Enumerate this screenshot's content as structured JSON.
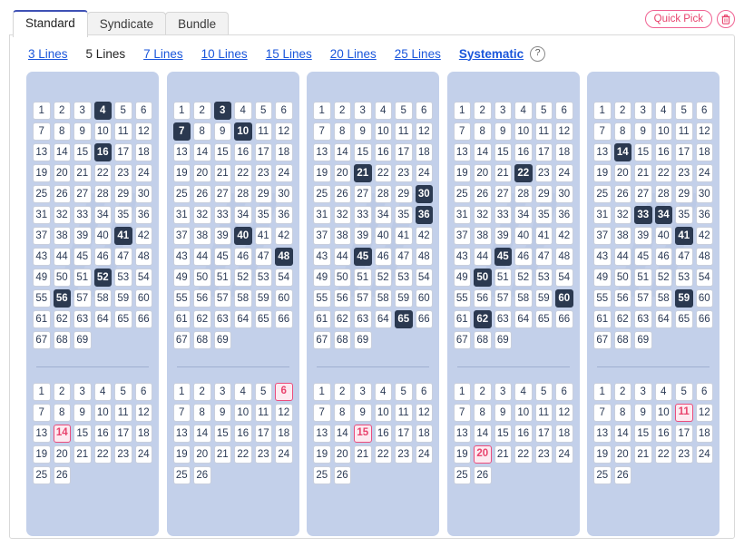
{
  "tabs": [
    {
      "label": "Standard",
      "active": true
    },
    {
      "label": "Syndicate",
      "active": false
    },
    {
      "label": "Bundle",
      "active": false
    }
  ],
  "actions": {
    "quick_pick_label": "Quick Pick",
    "trash_icon": "trash-icon"
  },
  "line_nav": {
    "items": [
      {
        "label": "3 Lines",
        "style": "link"
      },
      {
        "label": "5 Lines",
        "style": "plain"
      },
      {
        "label": "7 Lines",
        "style": "link"
      },
      {
        "label": "10 Lines",
        "style": "link"
      },
      {
        "label": "15 Lines",
        "style": "link"
      },
      {
        "label": "20 Lines",
        "style": "link"
      },
      {
        "label": "25 Lines",
        "style": "link"
      },
      {
        "label": "Systematic",
        "style": "link bold"
      }
    ],
    "help_icon_label": "?"
  },
  "board": {
    "main_range": {
      "min": 1,
      "max": 69,
      "columns": 6
    },
    "bonus_range": {
      "min": 1,
      "max": 26,
      "columns": 6
    },
    "colors": {
      "panel_bg": "#c3d0ea",
      "cell_bg": "#ffffff",
      "selected_bg": "#2b3950",
      "selected_text": "#ffffff",
      "bonus_selected_bg": "#fdeaf0",
      "bonus_selected_border": "#ec4c7c",
      "bonus_selected_text": "#e8436d",
      "accent_pink": "#f06292",
      "link_blue": "#1a56db",
      "active_tab_underline": "#3f51b5"
    },
    "lines": [
      {
        "main_selected": [
          4,
          16,
          41,
          52,
          56
        ],
        "bonus_selected": [
          14
        ]
      },
      {
        "main_selected": [
          3,
          7,
          10,
          40,
          48
        ],
        "bonus_selected": [
          6
        ]
      },
      {
        "main_selected": [
          21,
          30,
          36,
          45,
          65
        ],
        "bonus_selected": [
          15
        ]
      },
      {
        "main_selected": [
          22,
          45,
          50,
          60,
          62
        ],
        "bonus_selected": [
          20
        ]
      },
      {
        "main_selected": [
          14,
          33,
          34,
          41,
          59
        ],
        "bonus_selected": [
          11
        ]
      }
    ]
  }
}
